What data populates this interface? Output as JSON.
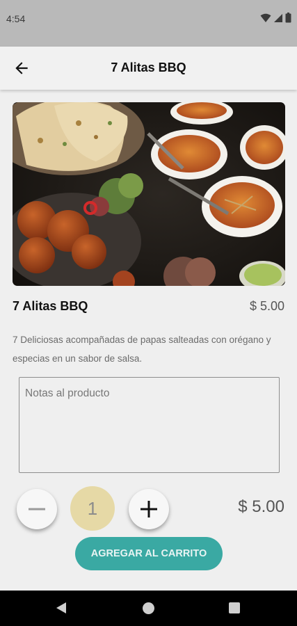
{
  "status_bar": {
    "time": "4:54"
  },
  "header": {
    "title": "7 Alitas BBQ"
  },
  "product": {
    "name": "7 Alitas BBQ",
    "price": "$ 5.00",
    "description": "7 Deliciosas acompañadas de papas salteadas con orégano y especias en un sabor de salsa."
  },
  "notes": {
    "placeholder": "Notas al producto",
    "value": ""
  },
  "quantity": {
    "minus_label": "−",
    "value": "1",
    "plus_label": "+"
  },
  "total": "$ 5.00",
  "actions": {
    "add_to_cart": "AGREGAR AL CARRITO"
  },
  "colors": {
    "accent": "#3aa9a3",
    "quantity_bg": "#e6d9a6",
    "status_bar": "#b9b9b9"
  }
}
